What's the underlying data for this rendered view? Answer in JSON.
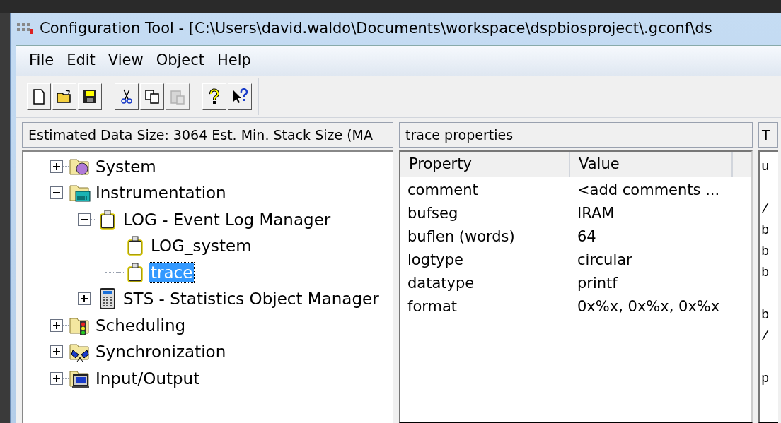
{
  "window": {
    "title": "Configuration Tool - [C:\\Users\\david.waldo\\Documents\\workspace\\dspbiosproject\\.gconf\\ds"
  },
  "menu": [
    {
      "label": "File"
    },
    {
      "label": "Edit"
    },
    {
      "label": "View"
    },
    {
      "label": "Object"
    },
    {
      "label": "Help"
    }
  ],
  "toolbar": [
    {
      "buttons": [
        {
          "kind": "new",
          "disabled": false
        },
        {
          "kind": "open",
          "disabled": false
        },
        {
          "kind": "save",
          "disabled": false
        }
      ]
    },
    {
      "buttons": [
        {
          "kind": "cut",
          "disabled": false
        },
        {
          "kind": "copy",
          "disabled": false
        },
        {
          "kind": "paste",
          "disabled": true
        }
      ]
    },
    {
      "buttons": [
        {
          "kind": "help",
          "disabled": false
        },
        {
          "kind": "context-help",
          "disabled": false
        }
      ]
    }
  ],
  "status": "Estimated Data Size: 3064   Est. Min. Stack Size (MA",
  "tree": [
    {
      "label": "System",
      "kind": "system",
      "expanded": false,
      "selected": false
    },
    {
      "label": "Instrumentation",
      "kind": "instrumentation",
      "expanded": true,
      "selected": false,
      "children": [
        {
          "label": "LOG - Event Log Manager",
          "kind": "log",
          "expanded": true,
          "selected": false,
          "children": [
            {
              "label": "LOG_system",
              "kind": "log",
              "selected": false
            },
            {
              "label": "trace",
              "kind": "log",
              "selected": true
            }
          ]
        },
        {
          "label": "STS - Statistics Object Manager",
          "kind": "sts",
          "expanded": false,
          "selected": false
        }
      ]
    },
    {
      "label": "Scheduling",
      "kind": "scheduling",
      "expanded": false,
      "selected": false
    },
    {
      "label": "Synchronization",
      "kind": "sync",
      "expanded": false,
      "selected": false
    },
    {
      "label": "Input/Output",
      "kind": "io",
      "expanded": false,
      "selected": false
    }
  ],
  "properties": {
    "title": "trace properties",
    "columns": [
      "Property",
      "Value"
    ],
    "rows": [
      {
        "property": "comment",
        "value": "<add comments ..."
      },
      {
        "property": "bufseg",
        "value": "IRAM"
      },
      {
        "property": "buflen (words)",
        "value": "64"
      },
      {
        "property": "logtype",
        "value": "circular"
      },
      {
        "property": "datatype",
        "value": "printf"
      },
      {
        "property": "format",
        "value": "0x%x, 0x%x, 0x%x"
      }
    ]
  },
  "text_panel": {
    "title": "T",
    "lines": [
      {
        "text": "u",
        "blank_before": false
      },
      {
        "text": "/",
        "blank_before": true
      },
      {
        "text": "b",
        "blank_before": false
      },
      {
        "text": "b",
        "blank_before": false
      },
      {
        "text": "b",
        "blank_before": false
      },
      {
        "text": "b",
        "blank_before": true
      },
      {
        "text": "/",
        "blank_before": false
      },
      {
        "text": "p",
        "blank_before": true
      }
    ]
  }
}
